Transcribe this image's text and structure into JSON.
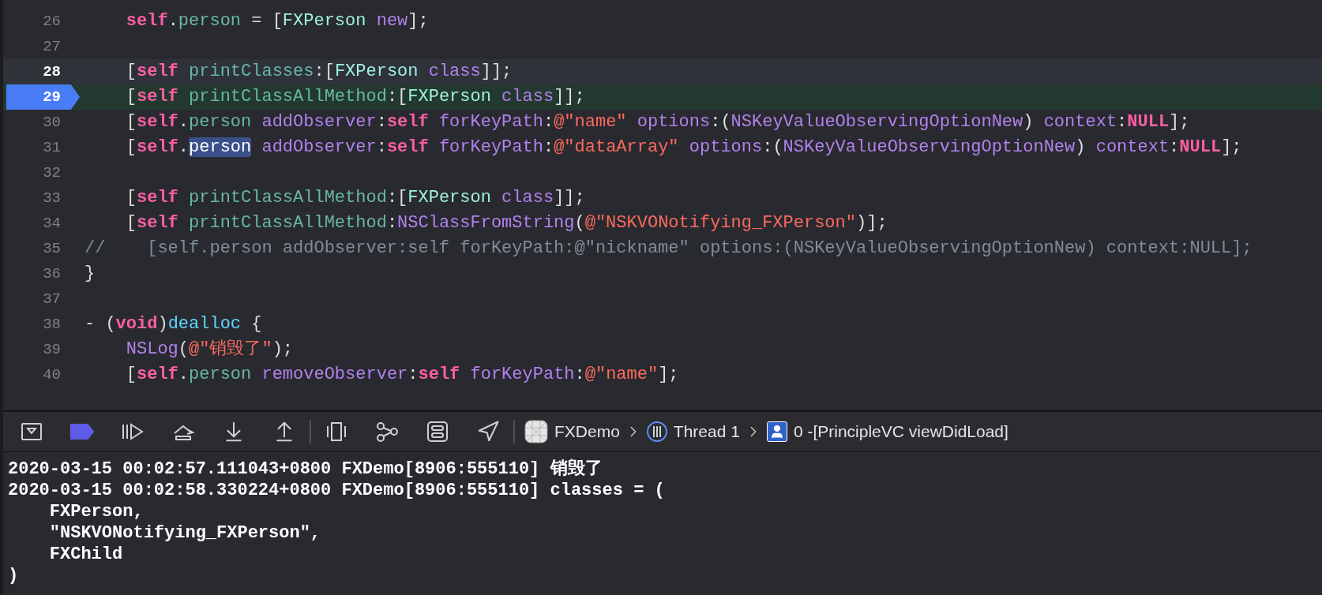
{
  "editor": {
    "lines": [
      {
        "number": "26",
        "current": false,
        "breakpoint": false,
        "tokens": [
          {
            "text": "    self",
            "kind": "keyword"
          },
          {
            "text": ".",
            "kind": "plain"
          },
          {
            "text": "person",
            "kind": "property"
          },
          {
            "text": " = [",
            "kind": "plain"
          },
          {
            "text": "FXPerson",
            "kind": "class"
          },
          {
            "text": " new",
            "kind": "system"
          },
          {
            "text": "];",
            "kind": "plain"
          }
        ]
      },
      {
        "number": "27",
        "current": false,
        "breakpoint": false
      },
      {
        "number": "28",
        "current": true,
        "breakpoint": false,
        "tokens": [
          {
            "text": "    [",
            "kind": "plain"
          },
          {
            "text": "self",
            "kind": "keyword"
          },
          {
            "text": " printClasses",
            "kind": "method"
          },
          {
            "text": ":[",
            "kind": "plain"
          },
          {
            "text": "FXPerson",
            "kind": "class"
          },
          {
            "text": " class",
            "kind": "system"
          },
          {
            "text": "]];",
            "kind": "plain"
          }
        ]
      },
      {
        "number": "29",
        "current": true,
        "breakpoint": true,
        "tokens": [
          {
            "text": "    [",
            "kind": "plain"
          },
          {
            "text": "self",
            "kind": "keyword"
          },
          {
            "text": " printClassAllMethod",
            "kind": "method"
          },
          {
            "text": ":[",
            "kind": "plain"
          },
          {
            "text": "FXPerson",
            "kind": "class"
          },
          {
            "text": " class",
            "kind": "system"
          },
          {
            "text": "]];",
            "kind": "plain"
          }
        ]
      },
      {
        "number": "30",
        "current": false,
        "breakpoint": false,
        "tokens": [
          {
            "text": "    [",
            "kind": "plain"
          },
          {
            "text": "self",
            "kind": "keyword"
          },
          {
            "text": ".",
            "kind": "plain"
          },
          {
            "text": "person",
            "kind": "property"
          },
          {
            "text": " addObserver",
            "kind": "system"
          },
          {
            "text": ":",
            "kind": "plain"
          },
          {
            "text": "self",
            "kind": "keyword"
          },
          {
            "text": " forKeyPath",
            "kind": "system"
          },
          {
            "text": ":",
            "kind": "plain"
          },
          {
            "text": "@\"name\"",
            "kind": "string"
          },
          {
            "text": " options",
            "kind": "system"
          },
          {
            "text": ":(",
            "kind": "plain"
          },
          {
            "text": "NSKeyValueObservingOptionNew",
            "kind": "system"
          },
          {
            "text": ") ",
            "kind": "plain"
          },
          {
            "text": "context",
            "kind": "system"
          },
          {
            "text": ":",
            "kind": "plain"
          },
          {
            "text": "NULL",
            "kind": "keyword"
          },
          {
            "text": "];",
            "kind": "plain"
          }
        ]
      },
      {
        "number": "31",
        "current": false,
        "breakpoint": false,
        "tokens": [
          {
            "text": "    [",
            "kind": "plain"
          },
          {
            "text": "self",
            "kind": "keyword"
          },
          {
            "text": ".",
            "kind": "plain"
          },
          {
            "text": "person",
            "kind": "selection"
          },
          {
            "text": " addObserver",
            "kind": "system"
          },
          {
            "text": ":",
            "kind": "plain"
          },
          {
            "text": "self",
            "kind": "keyword"
          },
          {
            "text": " forKeyPath",
            "kind": "system"
          },
          {
            "text": ":",
            "kind": "plain"
          },
          {
            "text": "@\"dataArray\"",
            "kind": "string"
          },
          {
            "text": " options",
            "kind": "system"
          },
          {
            "text": ":(",
            "kind": "plain"
          },
          {
            "text": "NSKeyValueObservingOptionNew",
            "kind": "system"
          },
          {
            "text": ") ",
            "kind": "plain"
          },
          {
            "text": "context",
            "kind": "system"
          },
          {
            "text": ":",
            "kind": "plain"
          },
          {
            "text": "NULL",
            "kind": "keyword"
          },
          {
            "text": "];",
            "kind": "plain"
          }
        ]
      },
      {
        "number": "32",
        "current": false,
        "breakpoint": false
      },
      {
        "number": "33",
        "current": false,
        "breakpoint": false,
        "tokens": [
          {
            "text": "    [",
            "kind": "plain"
          },
          {
            "text": "self",
            "kind": "keyword"
          },
          {
            "text": " printClassAllMethod",
            "kind": "method"
          },
          {
            "text": ":[",
            "kind": "plain"
          },
          {
            "text": "FXPerson",
            "kind": "class"
          },
          {
            "text": " class",
            "kind": "system"
          },
          {
            "text": "]];",
            "kind": "plain"
          }
        ]
      },
      {
        "number": "34",
        "current": false,
        "breakpoint": false,
        "tokens": [
          {
            "text": "    [",
            "kind": "plain"
          },
          {
            "text": "self",
            "kind": "keyword"
          },
          {
            "text": " printClassAllMethod",
            "kind": "method"
          },
          {
            "text": ":",
            "kind": "plain"
          },
          {
            "text": "NSClassFromString",
            "kind": "system"
          },
          {
            "text": "(",
            "kind": "plain"
          },
          {
            "text": "@\"NSKVONotifying_FXPerson\"",
            "kind": "string"
          },
          {
            "text": ")];",
            "kind": "plain"
          }
        ]
      },
      {
        "number": "35",
        "current": false,
        "breakpoint": false,
        "tokens": [
          {
            "text": "//    [self.person addObserver:self forKeyPath:@\"nickname\" options:(NSKeyValueObservingOptionNew) context:NULL];",
            "kind": "comment"
          }
        ]
      },
      {
        "number": "36",
        "current": false,
        "breakpoint": false,
        "tokens": [
          {
            "text": "}",
            "kind": "plain"
          }
        ]
      },
      {
        "number": "37",
        "current": false,
        "breakpoint": false
      },
      {
        "number": "38",
        "current": false,
        "breakpoint": false,
        "tokens": [
          {
            "text": "- (",
            "kind": "plain"
          },
          {
            "text": "void",
            "kind": "keyword"
          },
          {
            "text": ")",
            "kind": "plain"
          },
          {
            "text": "dealloc",
            "kind": "declaration"
          },
          {
            "text": " {",
            "kind": "plain"
          }
        ]
      },
      {
        "number": "39",
        "current": false,
        "breakpoint": false,
        "tokens": [
          {
            "text": "    NSLog",
            "kind": "system"
          },
          {
            "text": "(",
            "kind": "plain"
          },
          {
            "text": "@\"销毁了\"",
            "kind": "string"
          },
          {
            "text": ");",
            "kind": "plain"
          }
        ]
      },
      {
        "number": "40",
        "current": false,
        "breakpoint": false,
        "tokens": [
          {
            "text": "    [",
            "kind": "plain"
          },
          {
            "text": "self",
            "kind": "keyword"
          },
          {
            "text": ".",
            "kind": "plain"
          },
          {
            "text": "person",
            "kind": "property"
          },
          {
            "text": " removeObserver",
            "kind": "system"
          },
          {
            "text": ":",
            "kind": "plain"
          },
          {
            "text": "self",
            "kind": "keyword"
          },
          {
            "text": " forKeyPath",
            "kind": "system"
          },
          {
            "text": ":",
            "kind": "plain"
          },
          {
            "text": "@\"name\"",
            "kind": "string"
          },
          {
            "text": "];",
            "kind": "plain"
          }
        ]
      }
    ]
  },
  "debug_bar": {
    "breakpoints_active": true,
    "breadcrumbs": [
      {
        "kind": "app",
        "label": "FXDemo"
      },
      {
        "kind": "thread",
        "label": "Thread 1"
      },
      {
        "kind": "frame",
        "label": "0 -[PrincipleVC viewDidLoad]"
      }
    ]
  },
  "console": {
    "lines": [
      "2020-03-15 00:02:57.111043+0800 FXDemo[8906:555110] 销毁了",
      "2020-03-15 00:02:58.330224+0800 FXDemo[8906:555110] classes = (",
      "    FXPerson,",
      "    \"NSKVONotifying_FXPerson\",",
      "    FXChild",
      ")"
    ]
  }
}
